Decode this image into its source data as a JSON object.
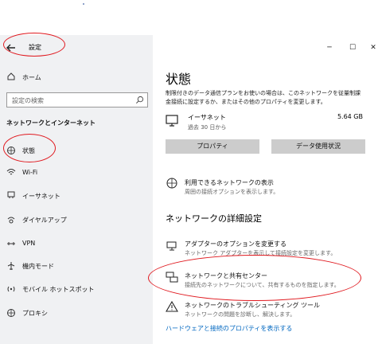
{
  "window": {
    "title": "設定"
  },
  "sidebar": {
    "home": "ホーム",
    "search_placeholder": "設定の検索",
    "section_title": "ネットワークとインターネット",
    "items": [
      "状態",
      "Wi-Fi",
      "イーサネット",
      "ダイヤルアップ",
      "VPN",
      "機内モード",
      "モバイル ホットスポット",
      "プロキシ"
    ]
  },
  "main": {
    "title": "状態",
    "desc": [
      "制限付きのデータ通信プランをお使いの場合は、このネットワークを従量制課",
      "金接続に設定するか、またはその他のプロパティを変更します。"
    ],
    "network": {
      "name": "イーサネット",
      "sub": "過去 30 日から",
      "size": "5.64 GB"
    },
    "buttons": [
      "プロパティ",
      "データ使用状況"
    ],
    "available": {
      "title": "利用できるネットワークの表示",
      "sub": "周囲の接続オプションを表示します。"
    },
    "advanced_title": "ネットワークの詳細設定",
    "adapter": {
      "title": "アダプターのオプションを変更する",
      "sub": "ネットワーク アダプターを表示して接続設定を変更します。"
    },
    "sharing": {
      "title": "ネットワークと共有センター",
      "sub": "接続先のネットワークについて、共有するものを指定します。"
    },
    "trouble": {
      "title": "ネットワークのトラブルシューティング ツール",
      "sub": "ネットワークの問題を診断し、解決します。"
    },
    "link": "ハードウェアと接続のプロパティを表示する"
  },
  "colors": {
    "annotation": "#e0191f",
    "link": "#0067c0",
    "button": "#cccccc",
    "sidebar": "#f0f1f3"
  },
  "icons": [
    "back-arrow-icon",
    "home-icon",
    "search-icon",
    "globe-icon",
    "wifi-icon",
    "ethernet-icon",
    "dialup-icon",
    "vpn-icon",
    "airplane-icon",
    "hotspot-icon",
    "proxy-icon",
    "computer-icon",
    "network-globe-icon",
    "adapter-icon",
    "sharing-center-icon",
    "warning-icon"
  ]
}
